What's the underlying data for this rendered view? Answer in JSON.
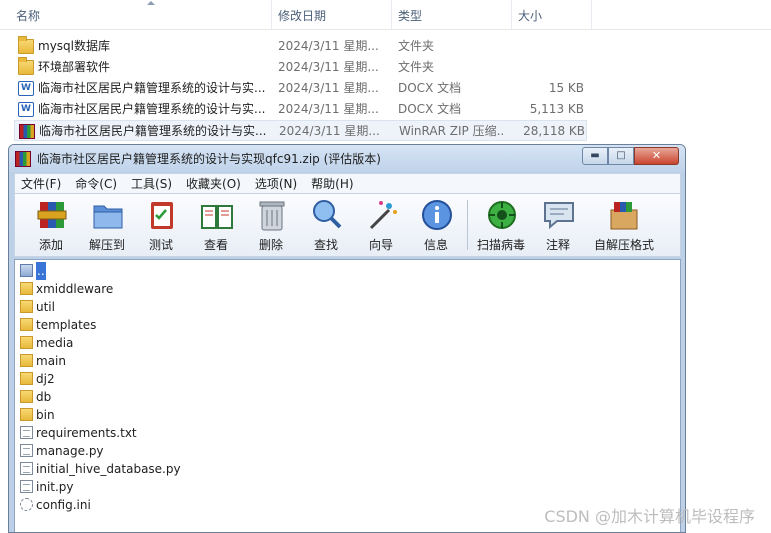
{
  "explorer": {
    "columns": [
      "名称",
      "修改日期",
      "类型",
      "大小"
    ],
    "rows": [
      {
        "name": "mysql数据库",
        "date": "2024/3/11 星期...",
        "type": "文件夹",
        "size": "",
        "icon": "folder-icon"
      },
      {
        "name": "环境部署软件",
        "date": "2024/3/11 星期...",
        "type": "文件夹",
        "size": "",
        "icon": "folder-icon"
      },
      {
        "name": "临海市社区居民户籍管理系统的设计与实...",
        "date": "2024/3/11 星期...",
        "type": "DOCX 文档",
        "size": "15 KB",
        "icon": "docx-icon"
      },
      {
        "name": "临海市社区居民户籍管理系统的设计与实...",
        "date": "2024/3/11 星期...",
        "type": "DOCX 文档",
        "size": "5,113 KB",
        "icon": "docx-icon"
      },
      {
        "name": "临海市社区居民户籍管理系统的设计与实...",
        "date": "2024/3/11 星期...",
        "type": "WinRAR ZIP 压缩...",
        "size": "28,118 KB",
        "icon": "winrar-archive-icon"
      }
    ]
  },
  "winrar": {
    "title": "临海市社区居民户籍管理系统的设计与实现qfc91.zip (评估版本)",
    "window_buttons": {
      "minimize": "▬",
      "maximize": "□",
      "close": "✕"
    },
    "menu": [
      "文件(F)",
      "命令(C)",
      "工具(S)",
      "收藏夹(O)",
      "选项(N)",
      "帮助(H)"
    ],
    "toolbar": [
      {
        "label": "添加",
        "icon": "add-archive-icon"
      },
      {
        "label": "解压到",
        "icon": "extract-to-folder-icon"
      },
      {
        "label": "测试",
        "icon": "test-clipboard-icon"
      },
      {
        "label": "查看",
        "icon": "view-book-icon"
      },
      {
        "label": "删除",
        "icon": "trash-icon"
      },
      {
        "label": "查找",
        "icon": "find-magnifier-icon"
      },
      {
        "label": "向导",
        "icon": "wizard-wand-icon"
      },
      {
        "label": "信息",
        "icon": "info-icon"
      },
      {
        "label": "扫描病毒",
        "icon": "virus-scan-icon"
      },
      {
        "label": "注释",
        "icon": "comment-icon"
      },
      {
        "label": "自解压格式",
        "icon": "sfx-box-icon"
      }
    ],
    "files": [
      {
        "name": "..",
        "kind": "up"
      },
      {
        "name": "xmiddleware",
        "kind": "folder"
      },
      {
        "name": "util",
        "kind": "folder"
      },
      {
        "name": "templates",
        "kind": "folder"
      },
      {
        "name": "media",
        "kind": "folder"
      },
      {
        "name": "main",
        "kind": "folder"
      },
      {
        "name": "dj2",
        "kind": "folder"
      },
      {
        "name": "db",
        "kind": "folder"
      },
      {
        "name": "bin",
        "kind": "folder"
      },
      {
        "name": "requirements.txt",
        "kind": "txt"
      },
      {
        "name": "manage.py",
        "kind": "txt"
      },
      {
        "name": "initial_hive_database.py",
        "kind": "txt"
      },
      {
        "name": "init.py",
        "kind": "txt"
      },
      {
        "name": "config.ini",
        "kind": "ini"
      }
    ]
  },
  "watermark": "CSDN @加木计算机毕设程序"
}
